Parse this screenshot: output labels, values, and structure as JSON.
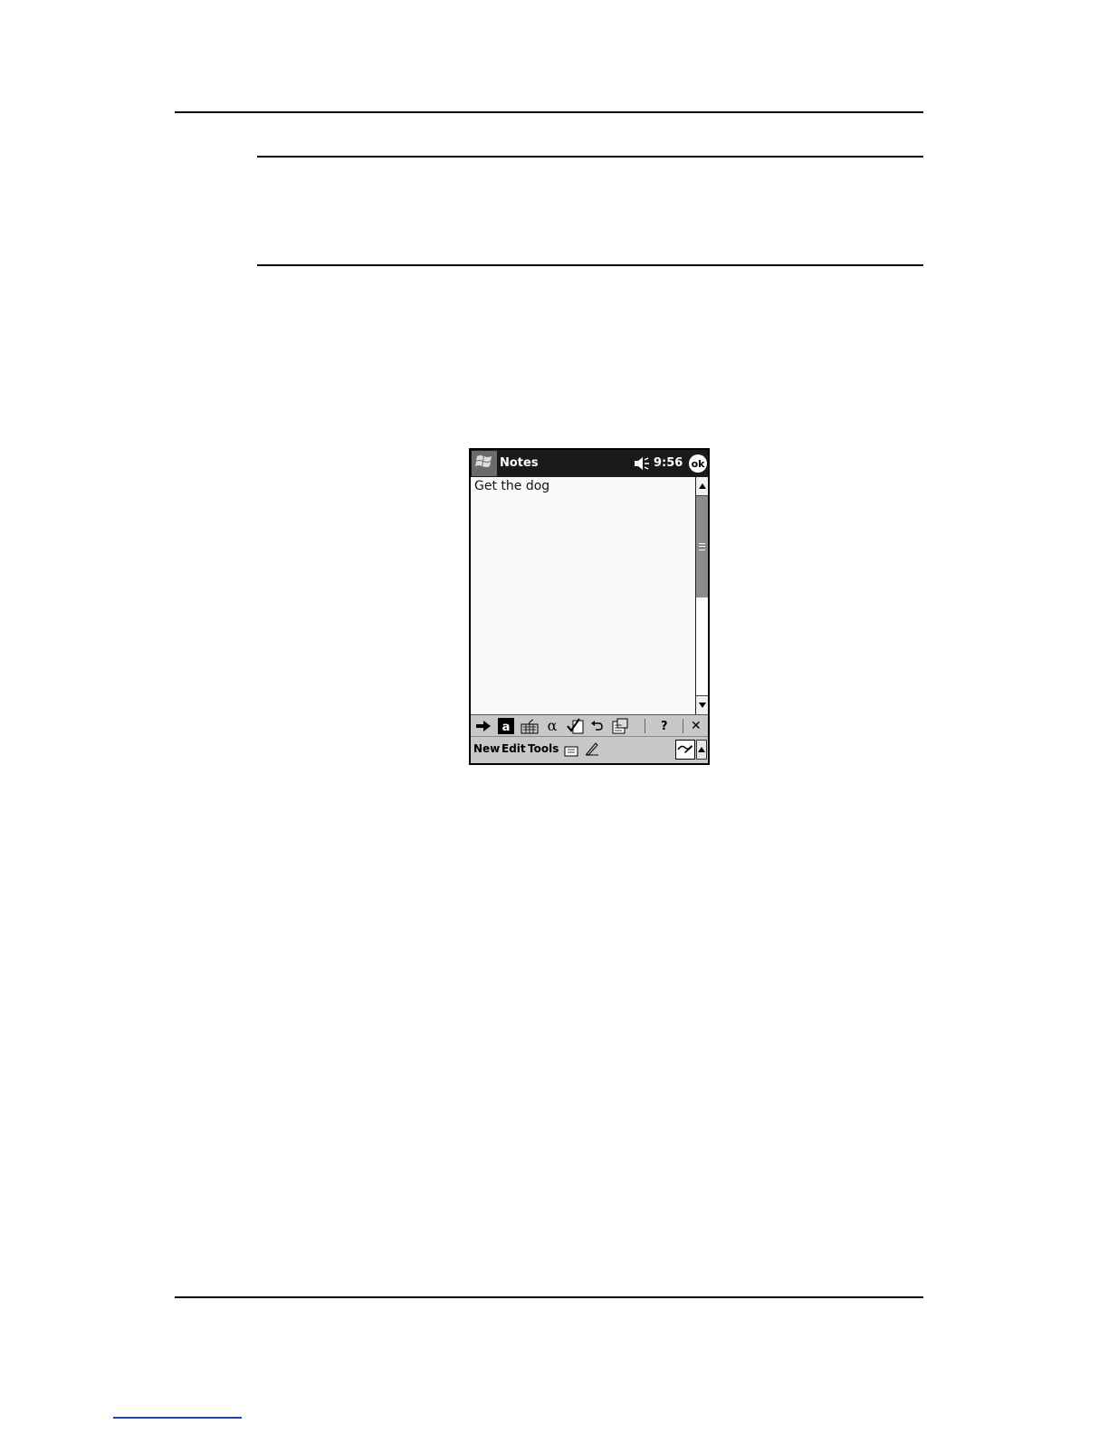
{
  "device": {
    "title": "Notes",
    "clock": "9:56",
    "ok_label": "ok",
    "note_text": "Get the dog",
    "menu": {
      "new": "New",
      "edit": "Edit",
      "tools": "Tools"
    },
    "toolbar_icons": [
      "enter-arrow-icon",
      "text-mode-icon",
      "keyboard-icon",
      "alpha-icon",
      "spell-check-icon",
      "undo-icon",
      "recognize-icon",
      "help-icon",
      "close-icon"
    ],
    "help_label": "?",
    "close_label": "✕"
  }
}
